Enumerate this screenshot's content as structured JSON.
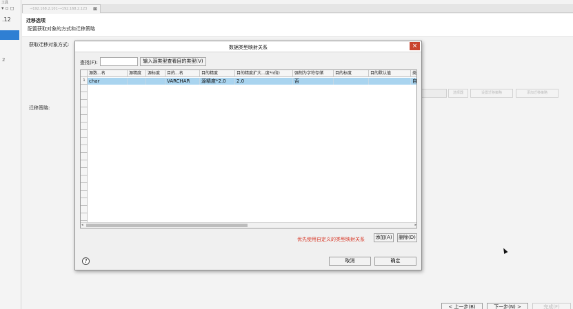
{
  "background": {
    "top_mark": "工具",
    "window_controls": "▾ ▫ ◻",
    "version_fragment": ".12",
    "list_number": "2",
    "tab_label": "→192.168.2.101-→192.168.2.123",
    "tab_close": "⊠",
    "section_title": "迁移选项",
    "section_desc": "配置获取对象的方式和迁移策略",
    "label_fetch_method": "获取迁移对象方式:",
    "label_strategy": "迁移策略:",
    "side_buttons": [
      "选择器",
      "设置迁移策略",
      "添加迁移策略"
    ],
    "bottom_buttons": [
      "< 上一步(B)",
      "下一步(N) >",
      "完成(F)"
    ]
  },
  "dialog": {
    "title": "数据类型映射关系",
    "close": "×",
    "find_label": "查找(F):",
    "find_value": "",
    "find_button": "输入源类型查看目的类型(V)",
    "table": {
      "columns": [
        "源数...名",
        "源精度",
        "源标度",
        "目的...名",
        "目的精度",
        "目的精度扩大...度*n倍)",
        "强制为字符存储",
        "目的标度",
        "目的默认值",
        "类"
      ],
      "rows": [
        {
          "num": "1",
          "cells": [
            "char",
            "",
            "",
            "VARCHAR",
            "源精度*2.0",
            "2.0",
            "否",
            "",
            "",
            "自定"
          ]
        }
      ],
      "empty_rows": 19
    },
    "hint": "优先使用自定义的类型映射关系",
    "add_button": "添加(A)",
    "delete_button": "删除(D)",
    "help": "?",
    "cancel_button": "取消",
    "ok_button": "确定"
  }
}
